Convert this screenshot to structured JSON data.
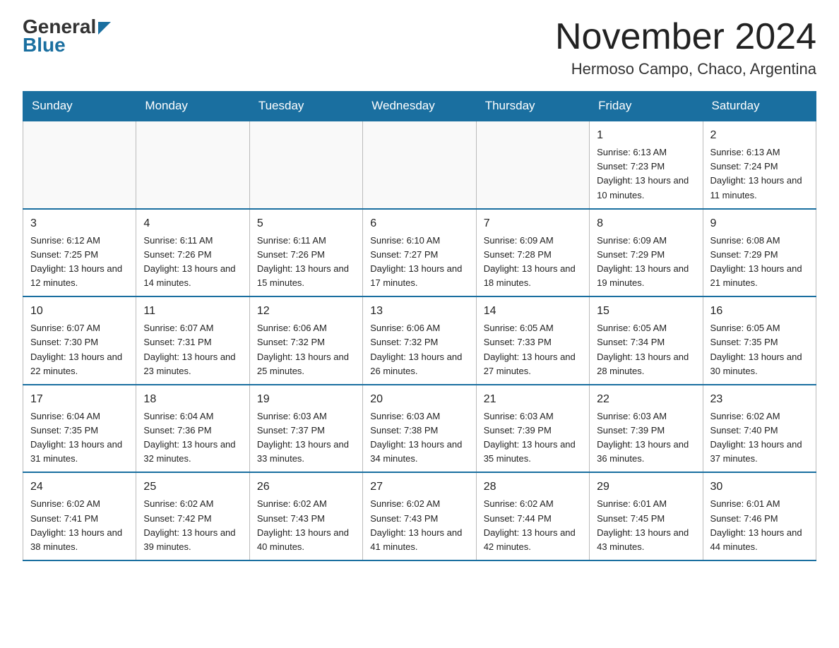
{
  "logo": {
    "general": "General",
    "blue": "Blue"
  },
  "title": {
    "month": "November 2024",
    "location": "Hermoso Campo, Chaco, Argentina"
  },
  "days_of_week": [
    "Sunday",
    "Monday",
    "Tuesday",
    "Wednesday",
    "Thursday",
    "Friday",
    "Saturday"
  ],
  "weeks": [
    [
      {
        "day": "",
        "info": ""
      },
      {
        "day": "",
        "info": ""
      },
      {
        "day": "",
        "info": ""
      },
      {
        "day": "",
        "info": ""
      },
      {
        "day": "",
        "info": ""
      },
      {
        "day": "1",
        "info": "Sunrise: 6:13 AM\nSunset: 7:23 PM\nDaylight: 13 hours and 10 minutes."
      },
      {
        "day": "2",
        "info": "Sunrise: 6:13 AM\nSunset: 7:24 PM\nDaylight: 13 hours and 11 minutes."
      }
    ],
    [
      {
        "day": "3",
        "info": "Sunrise: 6:12 AM\nSunset: 7:25 PM\nDaylight: 13 hours and 12 minutes."
      },
      {
        "day": "4",
        "info": "Sunrise: 6:11 AM\nSunset: 7:26 PM\nDaylight: 13 hours and 14 minutes."
      },
      {
        "day": "5",
        "info": "Sunrise: 6:11 AM\nSunset: 7:26 PM\nDaylight: 13 hours and 15 minutes."
      },
      {
        "day": "6",
        "info": "Sunrise: 6:10 AM\nSunset: 7:27 PM\nDaylight: 13 hours and 17 minutes."
      },
      {
        "day": "7",
        "info": "Sunrise: 6:09 AM\nSunset: 7:28 PM\nDaylight: 13 hours and 18 minutes."
      },
      {
        "day": "8",
        "info": "Sunrise: 6:09 AM\nSunset: 7:29 PM\nDaylight: 13 hours and 19 minutes."
      },
      {
        "day": "9",
        "info": "Sunrise: 6:08 AM\nSunset: 7:29 PM\nDaylight: 13 hours and 21 minutes."
      }
    ],
    [
      {
        "day": "10",
        "info": "Sunrise: 6:07 AM\nSunset: 7:30 PM\nDaylight: 13 hours and 22 minutes."
      },
      {
        "day": "11",
        "info": "Sunrise: 6:07 AM\nSunset: 7:31 PM\nDaylight: 13 hours and 23 minutes."
      },
      {
        "day": "12",
        "info": "Sunrise: 6:06 AM\nSunset: 7:32 PM\nDaylight: 13 hours and 25 minutes."
      },
      {
        "day": "13",
        "info": "Sunrise: 6:06 AM\nSunset: 7:32 PM\nDaylight: 13 hours and 26 minutes."
      },
      {
        "day": "14",
        "info": "Sunrise: 6:05 AM\nSunset: 7:33 PM\nDaylight: 13 hours and 27 minutes."
      },
      {
        "day": "15",
        "info": "Sunrise: 6:05 AM\nSunset: 7:34 PM\nDaylight: 13 hours and 28 minutes."
      },
      {
        "day": "16",
        "info": "Sunrise: 6:05 AM\nSunset: 7:35 PM\nDaylight: 13 hours and 30 minutes."
      }
    ],
    [
      {
        "day": "17",
        "info": "Sunrise: 6:04 AM\nSunset: 7:35 PM\nDaylight: 13 hours and 31 minutes."
      },
      {
        "day": "18",
        "info": "Sunrise: 6:04 AM\nSunset: 7:36 PM\nDaylight: 13 hours and 32 minutes."
      },
      {
        "day": "19",
        "info": "Sunrise: 6:03 AM\nSunset: 7:37 PM\nDaylight: 13 hours and 33 minutes."
      },
      {
        "day": "20",
        "info": "Sunrise: 6:03 AM\nSunset: 7:38 PM\nDaylight: 13 hours and 34 minutes."
      },
      {
        "day": "21",
        "info": "Sunrise: 6:03 AM\nSunset: 7:39 PM\nDaylight: 13 hours and 35 minutes."
      },
      {
        "day": "22",
        "info": "Sunrise: 6:03 AM\nSunset: 7:39 PM\nDaylight: 13 hours and 36 minutes."
      },
      {
        "day": "23",
        "info": "Sunrise: 6:02 AM\nSunset: 7:40 PM\nDaylight: 13 hours and 37 minutes."
      }
    ],
    [
      {
        "day": "24",
        "info": "Sunrise: 6:02 AM\nSunset: 7:41 PM\nDaylight: 13 hours and 38 minutes."
      },
      {
        "day": "25",
        "info": "Sunrise: 6:02 AM\nSunset: 7:42 PM\nDaylight: 13 hours and 39 minutes."
      },
      {
        "day": "26",
        "info": "Sunrise: 6:02 AM\nSunset: 7:43 PM\nDaylight: 13 hours and 40 minutes."
      },
      {
        "day": "27",
        "info": "Sunrise: 6:02 AM\nSunset: 7:43 PM\nDaylight: 13 hours and 41 minutes."
      },
      {
        "day": "28",
        "info": "Sunrise: 6:02 AM\nSunset: 7:44 PM\nDaylight: 13 hours and 42 minutes."
      },
      {
        "day": "29",
        "info": "Sunrise: 6:01 AM\nSunset: 7:45 PM\nDaylight: 13 hours and 43 minutes."
      },
      {
        "day": "30",
        "info": "Sunrise: 6:01 AM\nSunset: 7:46 PM\nDaylight: 13 hours and 44 minutes."
      }
    ]
  ]
}
